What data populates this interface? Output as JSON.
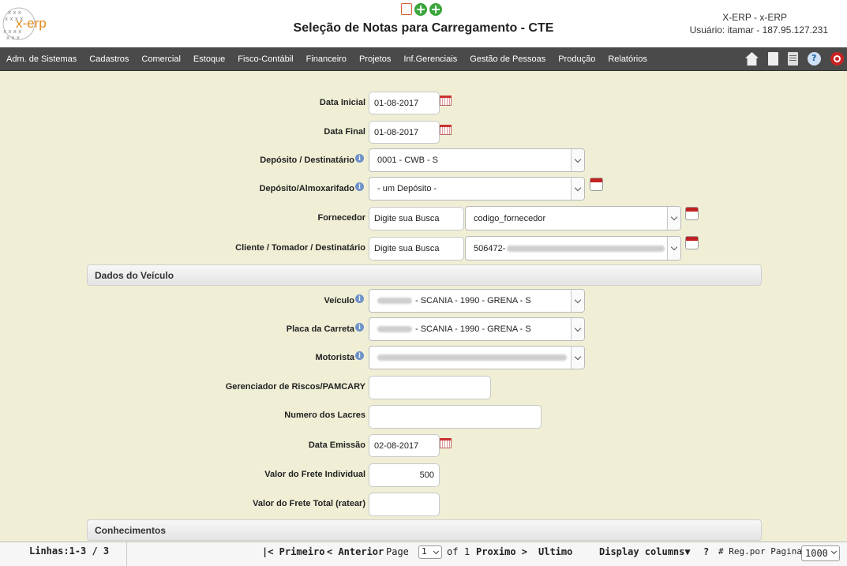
{
  "header": {
    "title": "Seleção de Notas para Carregamento - CTE",
    "app_name": "X-ERP - x-ERP",
    "user_info": "Usuário: itamar - 187.95.127.231",
    "logo_text": "x-erp"
  },
  "nav": {
    "items": [
      "Adm. de Sistemas",
      "Cadastros",
      "Comercial",
      "Estoque",
      "Fisco-Contábil",
      "Financeiro",
      "Projetos",
      "Inf.Gerenciais",
      "Gestão de Pessoas",
      "Produção",
      "Relatórios"
    ],
    "icons": [
      "home-icon",
      "document-icon",
      "report-icon",
      "help-icon",
      "power-icon"
    ]
  },
  "form": {
    "data_inicial": {
      "label": "Data Inicial",
      "value": "01-08-2017"
    },
    "data_final": {
      "label": "Data Final",
      "value": "01-08-2017"
    },
    "deposito_destinatario": {
      "label": "Depósito / Destinatário",
      "value": "0001 - CWB - S"
    },
    "deposito_almoxarifado": {
      "label": "Depósito/Almoxarifado",
      "value": "- um Depósito -"
    },
    "fornecedor": {
      "label": "Fornecedor",
      "search_value": "Digite sua Busca",
      "select_value": "codigo_fornecedor"
    },
    "cliente": {
      "label": "Cliente / Tomador / Destinatário",
      "search_value": "Digite sua Busca",
      "select_value": "506472-"
    }
  },
  "veiculo_section": {
    "title": "Dados do Veículo",
    "veiculo": {
      "label": "Veículo",
      "value": "- SCANIA - 1990 - GRENA - S"
    },
    "placa_carreta": {
      "label": "Placa da Carreta",
      "value": "- SCANIA - 1990 - GRENA - S"
    },
    "motorista": {
      "label": "Motorista",
      "value": ""
    },
    "gerenciador": {
      "label": "Gerenciador de Riscos/PAMCARY",
      "value": ""
    },
    "lacres": {
      "label": "Numero dos Lacres",
      "value": ""
    },
    "data_emissao": {
      "label": "Data Emissão",
      "value": "02-08-2017"
    },
    "frete_individual": {
      "label": "Valor do Frete Individual",
      "value": "500"
    },
    "frete_total": {
      "label": "Valor do Frete Total (ratear)",
      "value": ""
    }
  },
  "conhecimentos_section": {
    "title": "Conhecimentos"
  },
  "pager": {
    "lines_info": "Linhas:1-3 / 3",
    "first": "|< Primeiro",
    "previous": "< Anterior",
    "page_label": "Page",
    "page_value": "1",
    "of_label": "of",
    "total_pages": "1",
    "next": "Proximo >",
    "last": "Ultimo",
    "display_columns": "Display columns▼",
    "help": "?",
    "rows_per_page_label": "# Reg.por Pagina",
    "rows_per_page_value": "1000"
  },
  "colors": {
    "background": "#f0efd6",
    "navbar": "#4a4a4a",
    "logo": "#e08a1e"
  }
}
